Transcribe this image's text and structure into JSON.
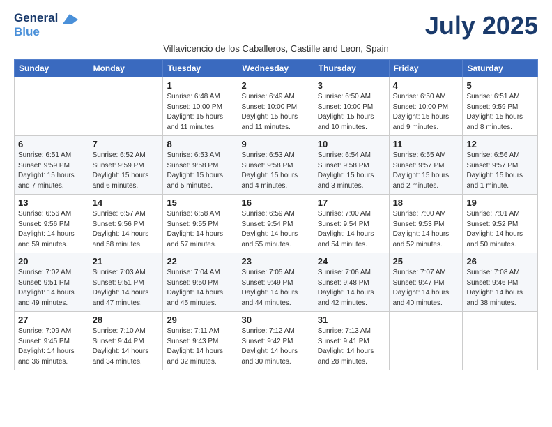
{
  "logo": {
    "line1": "General",
    "line2": "Blue"
  },
  "title": "July 2025",
  "subtitle": "Villavicencio de los Caballeros, Castille and Leon, Spain",
  "weekdays": [
    "Sunday",
    "Monday",
    "Tuesday",
    "Wednesday",
    "Thursday",
    "Friday",
    "Saturday"
  ],
  "weeks": [
    [
      {
        "day": "",
        "info": ""
      },
      {
        "day": "",
        "info": ""
      },
      {
        "day": "1",
        "info": "Sunrise: 6:48 AM\nSunset: 10:00 PM\nDaylight: 15 hours and 11 minutes."
      },
      {
        "day": "2",
        "info": "Sunrise: 6:49 AM\nSunset: 10:00 PM\nDaylight: 15 hours and 11 minutes."
      },
      {
        "day": "3",
        "info": "Sunrise: 6:50 AM\nSunset: 10:00 PM\nDaylight: 15 hours and 10 minutes."
      },
      {
        "day": "4",
        "info": "Sunrise: 6:50 AM\nSunset: 10:00 PM\nDaylight: 15 hours and 9 minutes."
      },
      {
        "day": "5",
        "info": "Sunrise: 6:51 AM\nSunset: 9:59 PM\nDaylight: 15 hours and 8 minutes."
      }
    ],
    [
      {
        "day": "6",
        "info": "Sunrise: 6:51 AM\nSunset: 9:59 PM\nDaylight: 15 hours and 7 minutes."
      },
      {
        "day": "7",
        "info": "Sunrise: 6:52 AM\nSunset: 9:59 PM\nDaylight: 15 hours and 6 minutes."
      },
      {
        "day": "8",
        "info": "Sunrise: 6:53 AM\nSunset: 9:58 PM\nDaylight: 15 hours and 5 minutes."
      },
      {
        "day": "9",
        "info": "Sunrise: 6:53 AM\nSunset: 9:58 PM\nDaylight: 15 hours and 4 minutes."
      },
      {
        "day": "10",
        "info": "Sunrise: 6:54 AM\nSunset: 9:58 PM\nDaylight: 15 hours and 3 minutes."
      },
      {
        "day": "11",
        "info": "Sunrise: 6:55 AM\nSunset: 9:57 PM\nDaylight: 15 hours and 2 minutes."
      },
      {
        "day": "12",
        "info": "Sunrise: 6:56 AM\nSunset: 9:57 PM\nDaylight: 15 hours and 1 minute."
      }
    ],
    [
      {
        "day": "13",
        "info": "Sunrise: 6:56 AM\nSunset: 9:56 PM\nDaylight: 14 hours and 59 minutes."
      },
      {
        "day": "14",
        "info": "Sunrise: 6:57 AM\nSunset: 9:56 PM\nDaylight: 14 hours and 58 minutes."
      },
      {
        "day": "15",
        "info": "Sunrise: 6:58 AM\nSunset: 9:55 PM\nDaylight: 14 hours and 57 minutes."
      },
      {
        "day": "16",
        "info": "Sunrise: 6:59 AM\nSunset: 9:54 PM\nDaylight: 14 hours and 55 minutes."
      },
      {
        "day": "17",
        "info": "Sunrise: 7:00 AM\nSunset: 9:54 PM\nDaylight: 14 hours and 54 minutes."
      },
      {
        "day": "18",
        "info": "Sunrise: 7:00 AM\nSunset: 9:53 PM\nDaylight: 14 hours and 52 minutes."
      },
      {
        "day": "19",
        "info": "Sunrise: 7:01 AM\nSunset: 9:52 PM\nDaylight: 14 hours and 50 minutes."
      }
    ],
    [
      {
        "day": "20",
        "info": "Sunrise: 7:02 AM\nSunset: 9:51 PM\nDaylight: 14 hours and 49 minutes."
      },
      {
        "day": "21",
        "info": "Sunrise: 7:03 AM\nSunset: 9:51 PM\nDaylight: 14 hours and 47 minutes."
      },
      {
        "day": "22",
        "info": "Sunrise: 7:04 AM\nSunset: 9:50 PM\nDaylight: 14 hours and 45 minutes."
      },
      {
        "day": "23",
        "info": "Sunrise: 7:05 AM\nSunset: 9:49 PM\nDaylight: 14 hours and 44 minutes."
      },
      {
        "day": "24",
        "info": "Sunrise: 7:06 AM\nSunset: 9:48 PM\nDaylight: 14 hours and 42 minutes."
      },
      {
        "day": "25",
        "info": "Sunrise: 7:07 AM\nSunset: 9:47 PM\nDaylight: 14 hours and 40 minutes."
      },
      {
        "day": "26",
        "info": "Sunrise: 7:08 AM\nSunset: 9:46 PM\nDaylight: 14 hours and 38 minutes."
      }
    ],
    [
      {
        "day": "27",
        "info": "Sunrise: 7:09 AM\nSunset: 9:45 PM\nDaylight: 14 hours and 36 minutes."
      },
      {
        "day": "28",
        "info": "Sunrise: 7:10 AM\nSunset: 9:44 PM\nDaylight: 14 hours and 34 minutes."
      },
      {
        "day": "29",
        "info": "Sunrise: 7:11 AM\nSunset: 9:43 PM\nDaylight: 14 hours and 32 minutes."
      },
      {
        "day": "30",
        "info": "Sunrise: 7:12 AM\nSunset: 9:42 PM\nDaylight: 14 hours and 30 minutes."
      },
      {
        "day": "31",
        "info": "Sunrise: 7:13 AM\nSunset: 9:41 PM\nDaylight: 14 hours and 28 minutes."
      },
      {
        "day": "",
        "info": ""
      },
      {
        "day": "",
        "info": ""
      }
    ]
  ]
}
